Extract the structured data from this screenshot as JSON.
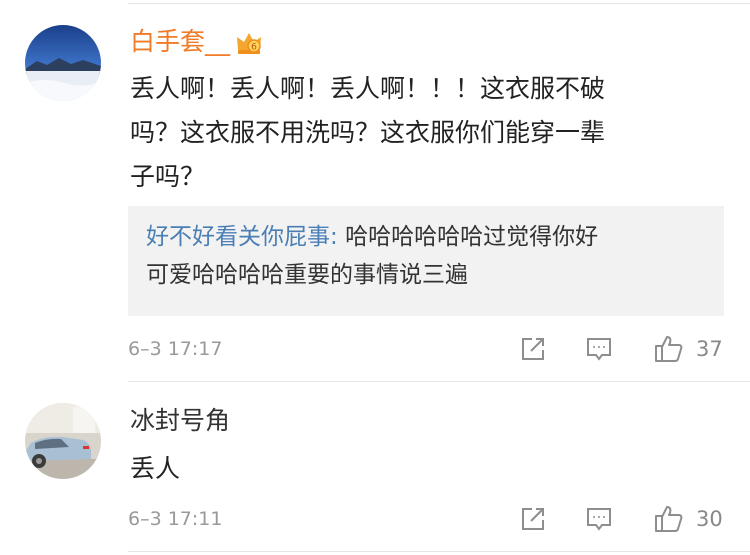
{
  "colors": {
    "vip_name": "#f07b28",
    "reply_author": "#4a7fb5",
    "meta": "#999999"
  },
  "comments": [
    {
      "username": "白手套__",
      "badge_icon": "vip-crown-icon",
      "text_lines": [
        "丢人啊！丢人啊！丢人啊！！！这衣服不破",
        "吗？这衣服不用洗吗？这衣服你们能穿一辈",
        "子吗？"
      ],
      "reply": {
        "author": "好不好看关你屁事",
        "separator": ": ",
        "text_line1": "哈哈哈哈哈哈过觉得你好",
        "text_line2": "可爱哈哈哈哈重要的事情说三遍"
      },
      "timestamp": "6–3 17:17",
      "like_count": "37"
    },
    {
      "username": "冰封号角",
      "text_lines": [
        "丢人"
      ],
      "timestamp": "6–3 17:11",
      "like_count": "30"
    }
  ]
}
